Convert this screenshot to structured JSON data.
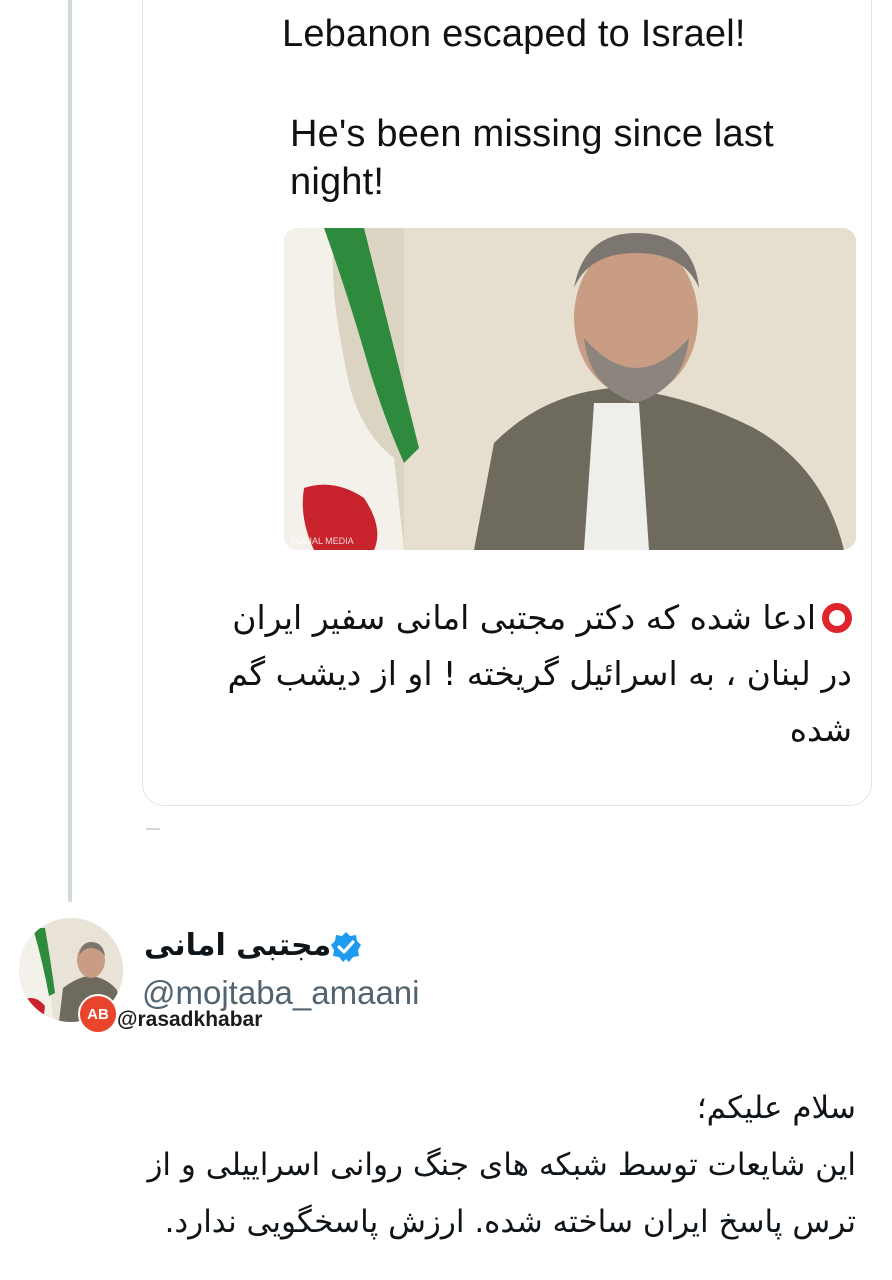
{
  "quoted_tweet": {
    "text_en_line1": "Lebanon escaped to Israel!",
    "text_en_line2": "He's been missing since last night!",
    "image_alt": "portrait with flag",
    "image_watermark": "SOCIAL MEDIA",
    "text_fa": "ادعا شده که دکتر مجتبی امانی سفیر ایران در لبنان ، به اسرائیل گریخته ! او از دیشب گم شده",
    "bullet_icon": "red-circle-icon"
  },
  "author": {
    "display_name": "مجتبی امانی",
    "handle": "@mojtaba_amaani",
    "verified": true,
    "verified_color": "#1d9bf0"
  },
  "watermark": {
    "logo_text": "AB",
    "handle": "@rasadkhabar"
  },
  "tweet": {
    "lines": [
      "سلام علیکم؛",
      "این شایعات توسط شبکه های جنگ روانی اسراییلی و از",
      "ترس پاسخ ایران ساخته شده. ارزش پاسخگویی ندارد."
    ]
  },
  "colors": {
    "thread_line": "#cfd9de",
    "handle_grey": "#536471",
    "bullet_red": "#e0242b"
  }
}
